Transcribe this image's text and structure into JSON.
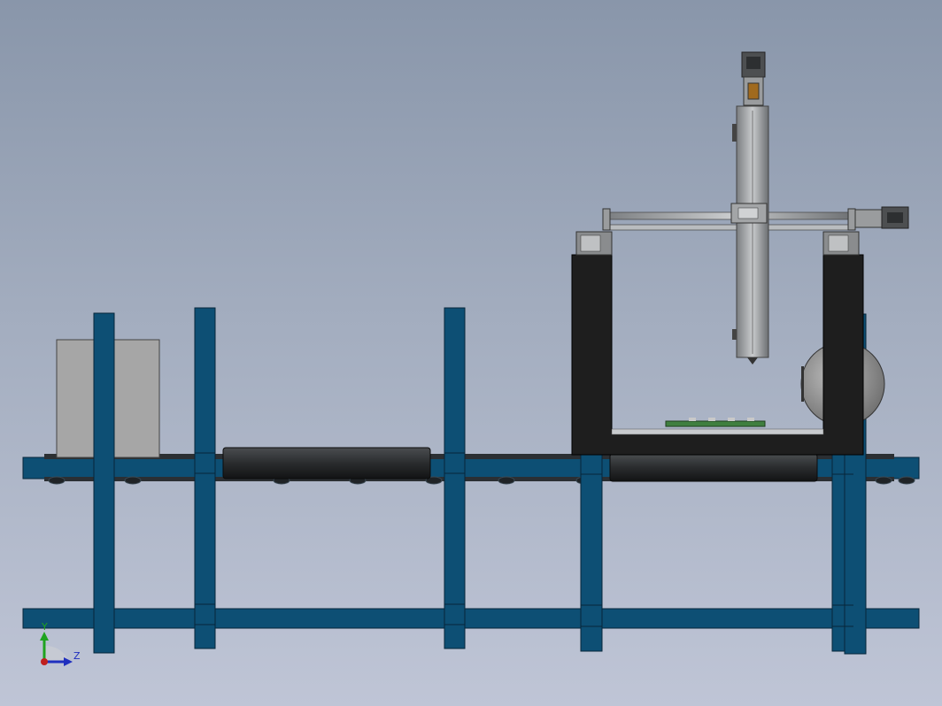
{
  "triad": {
    "y_label": "Y",
    "z_label": "Z"
  },
  "colors": {
    "frame": "#0d4f74",
    "frame_edge": "#06263a",
    "belt": "#2b2f33",
    "enclosure": "#1e1e1e",
    "gray_block": "#a6a6a6",
    "pcb": "#3f7f3f"
  },
  "icons": {
    "triad": "coordinate-triad-icon"
  }
}
